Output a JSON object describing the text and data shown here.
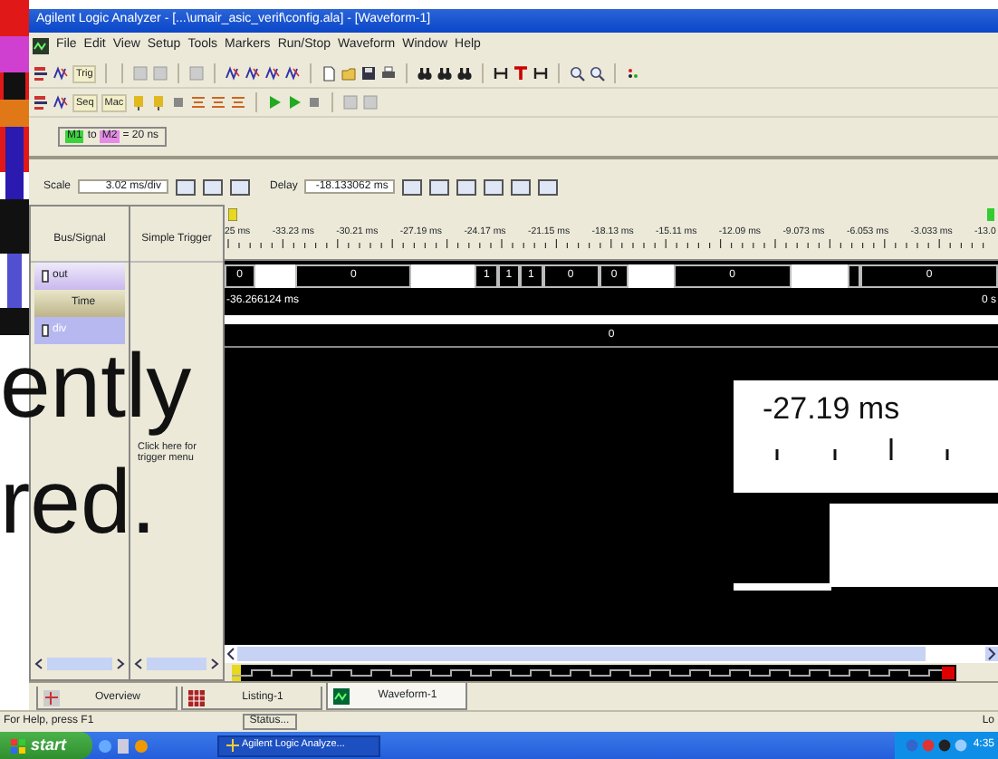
{
  "window": {
    "title": "Agilent Logic Analyzer - [...\\umair_asic_verif\\config.ala] - [Waveform-1]"
  },
  "menu": [
    "File",
    "Edit",
    "View",
    "Setup",
    "Tools",
    "Markers",
    "Run/Stop",
    "Waveform",
    "Window",
    "Help"
  ],
  "toolbar_1": {
    "text_buttons": [
      "Trig"
    ]
  },
  "toolbar_2": {
    "text_buttons": [
      "Seq",
      "Mac"
    ]
  },
  "marker_bar": {
    "m1": "M1",
    "to": "to",
    "m2": "M2",
    "value": "= 20 ns"
  },
  "scale": {
    "label": "Scale",
    "value": "3.02 ms/div"
  },
  "delay": {
    "label": "Delay",
    "value": "-18.133062 ms"
  },
  "columns": [
    "Bus/Signal",
    "Simple Trigger"
  ],
  "signals": [
    {
      "name": "out",
      "kind": "signal",
      "selected": false
    },
    {
      "name": "Time",
      "kind": "time",
      "selected": false
    },
    {
      "name": "div",
      "kind": "signal",
      "selected": true
    }
  ],
  "trigger_hint": "Click here for trigger menu",
  "ruler": [
    "25 ms",
    "-33.23 ms",
    "-30.21 ms",
    "-27.19 ms",
    "-24.17 ms",
    "-21.15 ms",
    "-18.13 ms",
    "-15.11 ms",
    "-12.09 ms",
    "-9.073 ms",
    "-6.053 ms",
    "-3.033 ms",
    "-13.0"
  ],
  "out_segments": [
    {
      "kind": "bus",
      "label": "0"
    },
    {
      "kind": "high"
    },
    {
      "kind": "bus",
      "label": "0"
    },
    {
      "kind": "high"
    },
    {
      "kind": "bus",
      "label": "1"
    },
    {
      "kind": "bus",
      "label": "1"
    },
    {
      "kind": "bus",
      "label": "1"
    },
    {
      "kind": "bus",
      "label": "0"
    },
    {
      "kind": "bus",
      "label": "0"
    },
    {
      "kind": "high"
    },
    {
      "kind": "bus",
      "label": "0"
    },
    {
      "kind": "high"
    },
    {
      "kind": "bus"
    },
    {
      "kind": "bus",
      "label": "0"
    }
  ],
  "time_row": {
    "start": "-36.266124 ms",
    "end": "0 s"
  },
  "div_row": {
    "label": "0"
  },
  "tabs": [
    {
      "label": "Overview",
      "selected": false
    },
    {
      "label": "Listing-1",
      "selected": false
    },
    {
      "label": "Waveform-1",
      "selected": true
    }
  ],
  "status_bar": {
    "help": "For Help, press F1",
    "button": "Status...",
    "right": "Lo"
  },
  "taskbar": {
    "start": "start",
    "task": "Agilent Logic Analyze...",
    "clock": "4:35"
  },
  "slide_text": [
    "ently",
    "red."
  ],
  "inset": {
    "label": "-27.19 ms"
  }
}
